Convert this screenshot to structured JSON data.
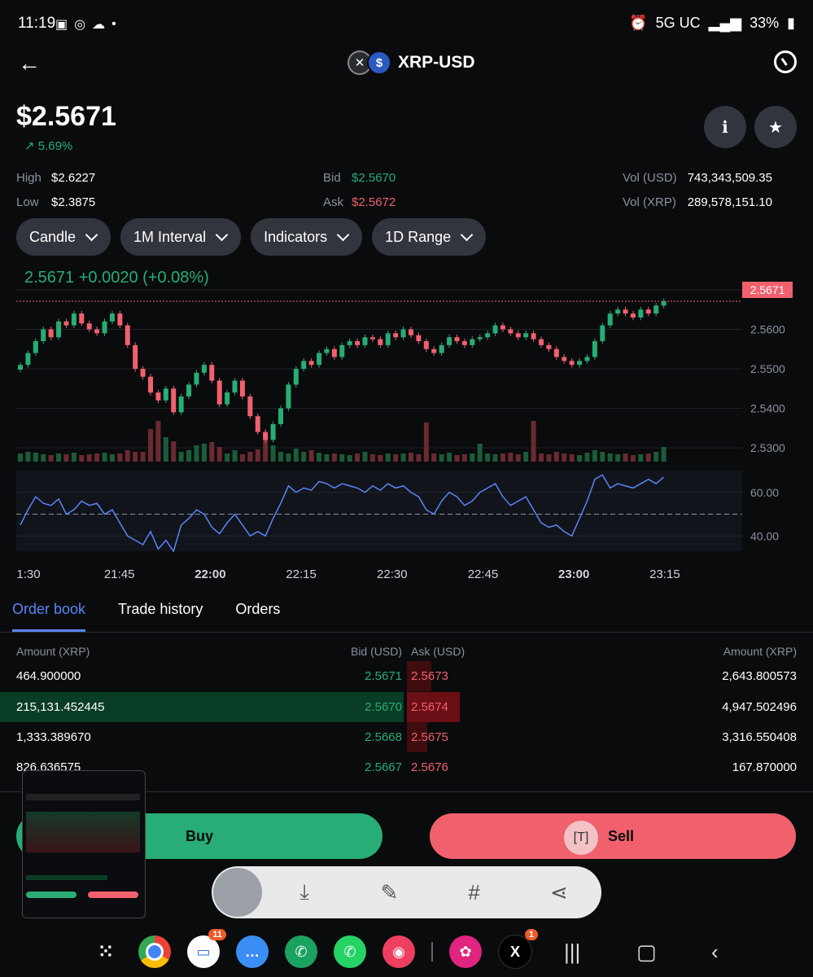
{
  "status_bar": {
    "time": "11:19",
    "network": "5G UC",
    "battery": "33%"
  },
  "header": {
    "title": "XRP-USD"
  },
  "ticker": {
    "price": "$2.5671",
    "change": "↗ 5.69%"
  },
  "stats": {
    "high_label": "High",
    "high": "$2.6227",
    "low_label": "Low",
    "low": "$2.3875",
    "bid_label": "Bid",
    "bid": "$2.5670",
    "ask_label": "Ask",
    "ask": "$2.5672",
    "vol_usd_label": "Vol (USD)",
    "vol_usd": "743,343,509.35",
    "vol_xrp_label": "Vol (XRP)",
    "vol_xrp": "289,578,151.10"
  },
  "controls": [
    "Candle",
    "1M Interval",
    "Indicators",
    "1D Range"
  ],
  "chart_data": {
    "type": "candlestick",
    "summary": "2.5671 +0.0020 (+0.08%)",
    "last_price_tag": "2.5671",
    "y_ticks": [
      "2.5700",
      "2.5600",
      "2.5500",
      "2.5400",
      "2.5300"
    ],
    "ylim": [
      2.5265,
      2.5735
    ],
    "x_ticks": [
      "1:30",
      "21:45",
      "22:00",
      "22:15",
      "22:30",
      "22:45",
      "23:00",
      "23:15"
    ],
    "closes": [
      2.551,
      2.554,
      2.557,
      2.56,
      2.558,
      2.562,
      2.561,
      2.564,
      2.5615,
      2.56,
      2.559,
      2.562,
      2.564,
      2.561,
      2.556,
      2.55,
      2.548,
      2.544,
      2.542,
      2.545,
      2.539,
      2.543,
      2.546,
      2.549,
      2.551,
      2.547,
      2.541,
      2.544,
      2.547,
      2.543,
      2.538,
      2.534,
      2.532,
      2.536,
      2.54,
      2.546,
      2.55,
      2.552,
      2.551,
      2.554,
      2.555,
      2.553,
      2.556,
      2.557,
      2.556,
      2.558,
      2.5575,
      2.556,
      2.559,
      2.558,
      2.56,
      2.5585,
      2.557,
      2.555,
      2.554,
      2.556,
      2.558,
      2.557,
      2.556,
      2.5575,
      2.558,
      2.559,
      2.561,
      2.56,
      2.559,
      2.558,
      2.559,
      2.5575,
      2.556,
      2.555,
      2.553,
      2.552,
      2.551,
      2.552,
      2.553,
      2.557,
      2.561,
      2.564,
      2.565,
      2.564,
      2.563,
      2.565,
      2.564,
      2.566,
      2.5671
    ],
    "volumes": [
      10,
      12,
      11,
      9,
      8,
      10,
      9,
      11,
      8,
      9,
      10,
      11,
      9,
      10,
      14,
      12,
      12,
      40,
      50,
      30,
      25,
      12,
      14,
      20,
      22,
      24,
      18,
      10,
      14,
      9,
      12,
      15,
      35,
      20,
      12,
      10,
      16,
      12,
      14,
      11,
      9,
      10,
      9,
      8,
      10,
      12,
      9,
      8,
      10,
      9,
      10,
      11,
      9,
      48,
      10,
      9,
      11,
      8,
      9,
      10,
      22,
      10,
      9,
      10,
      11,
      9,
      12,
      50,
      10,
      9,
      12,
      10,
      9,
      8,
      11,
      14,
      12,
      10,
      9,
      10,
      8,
      9,
      10,
      12,
      18
    ],
    "rsi": [
      45,
      52,
      58,
      55,
      54,
      57,
      50,
      52,
      56,
      54,
      55,
      50,
      52,
      46,
      40,
      38,
      36,
      42,
      34,
      38,
      33,
      45,
      48,
      52,
      50,
      44,
      41,
      46,
      50,
      45,
      40,
      42,
      40,
      48,
      55,
      63,
      60,
      62,
      61,
      65,
      64,
      62,
      64,
      63,
      62,
      60,
      63,
      61,
      64,
      62,
      63,
      60,
      58,
      52,
      50,
      56,
      60,
      58,
      54,
      56,
      60,
      62,
      64,
      58,
      54,
      56,
      58,
      52,
      46,
      44,
      45,
      42,
      40,
      48,
      56,
      66,
      68,
      62,
      64,
      63,
      62,
      64,
      66,
      64,
      67
    ],
    "rsi_ticks": [
      "60.00",
      "40.00"
    ],
    "rsi_ylim": [
      33,
      70
    ]
  },
  "tabs": [
    "Order book",
    "Trade history",
    "Orders"
  ],
  "order_book": {
    "headers": {
      "amount_left": "Amount (XRP)",
      "bid": "Bid (USD)",
      "ask": "Ask (USD)",
      "amount_right": "Amount (XRP)"
    },
    "rows": [
      {
        "bid_amount": "464.900000",
        "bid": "2.5671",
        "ask": "2.5673",
        "ask_amount": "2,643.800573"
      },
      {
        "bid_amount": "215,131.452445",
        "bid": "2.5670",
        "ask": "2.5674",
        "ask_amount": "4,947.502496"
      },
      {
        "bid_amount": "1,333.389670",
        "bid": "2.5668",
        "ask": "2.5675",
        "ask_amount": "3,316.550408"
      },
      {
        "bid_amount": "826.636575",
        "bid": "2.5667",
        "ask": "2.5676",
        "ask_amount": "167.870000"
      }
    ]
  },
  "actions": {
    "buy": "Buy",
    "sell": "Sell"
  },
  "dock": {
    "messages_badge": "11",
    "x_badge": "1"
  },
  "colors": {
    "green": "#27ad75",
    "red": "#f0616d",
    "accent": "#5a85f5",
    "background": "#0a0b0d"
  }
}
